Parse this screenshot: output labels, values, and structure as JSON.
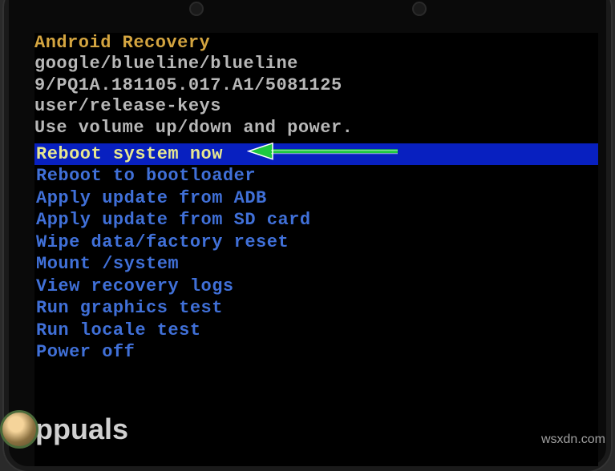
{
  "header": {
    "title": "Android Recovery",
    "device": "google/blueline/blueline",
    "build": "9/PQ1A.181105.017.A1/5081125",
    "buildtype": "user/release-keys",
    "instruction": "Use volume up/down and power."
  },
  "menu": {
    "items": [
      "Reboot system now",
      "Reboot to bootloader",
      "Apply update from ADB",
      "Apply update from SD card",
      "Wipe data/factory reset",
      "Mount /system",
      "View recovery logs",
      "Run graphics test",
      "Run locale test",
      "Power off"
    ],
    "selected_index": 0
  },
  "watermark": {
    "left": "ppuals",
    "right": "wsxdn.com"
  }
}
